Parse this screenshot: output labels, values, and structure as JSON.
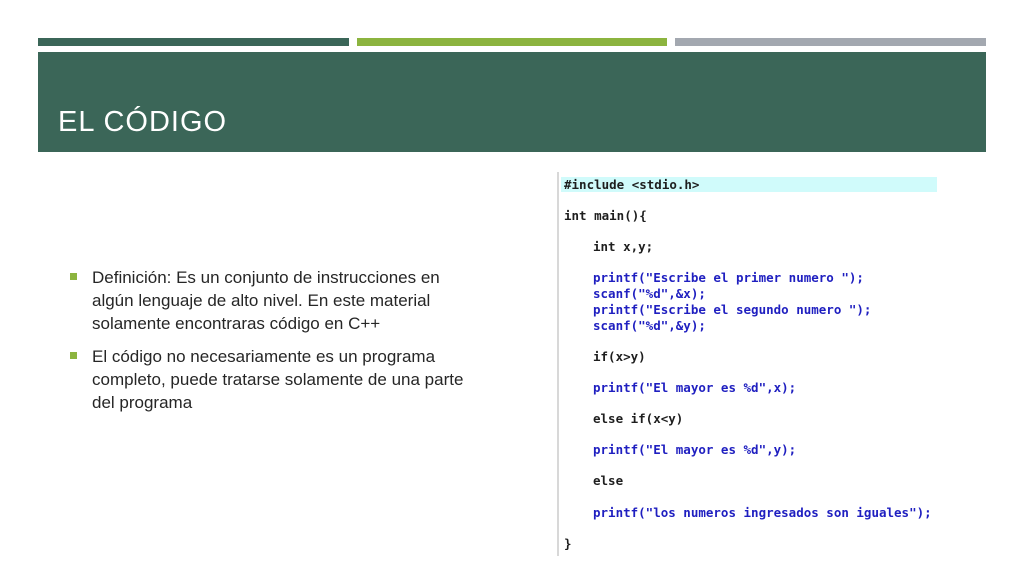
{
  "slide": {
    "title": "EL CÓDIGO",
    "bullets": [
      "Definición: Es un conjunto de instrucciones en algún lenguaje de alto nivel. En este material solamente encontraras código en C++",
      "El código no necesariamente es un programa completo, puede tratarse solamente de una parte del programa"
    ]
  },
  "code": {
    "lines": [
      "#include <stdio.h>",
      "int main(){",
      "int x,y;",
      "printf(\"Escribe el primer numero \");",
      "scanf(\"%d\",&x);",
      "printf(\"Escribe el segundo numero \");",
      "scanf(\"%d\",&y);",
      "if(x>y)",
      "printf(\"El mayor es %d\",x);",
      "else if(x<y)",
      "printf(\"El mayor es %d\",y);",
      "else",
      "printf(\"los numeros ingresados son iguales\");",
      "}"
    ]
  },
  "colors": {
    "header": "#3b6658",
    "accent": "#8cb43f",
    "gray": "#a3a8b0",
    "code_highlight": "#d0fbfb"
  }
}
